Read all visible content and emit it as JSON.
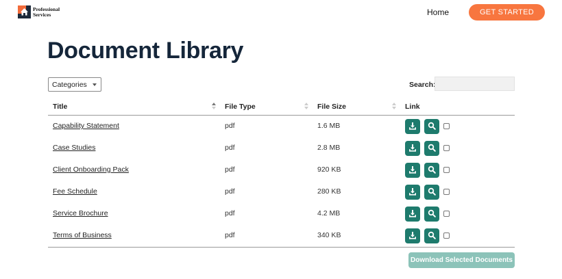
{
  "header": {
    "logo_line1": "Professional",
    "logo_line2": "Services",
    "nav_home": "Home",
    "cta_label": "GET STARTED"
  },
  "page": {
    "title": "Document Library"
  },
  "controls": {
    "categories_label": "Categories",
    "search_label": "Search:",
    "search_value": ""
  },
  "table": {
    "columns": [
      "Title",
      "File Type",
      "File Size",
      "Link"
    ],
    "rows": [
      {
        "title": "Capability Statement",
        "type": "pdf",
        "size": "1.6 MB"
      },
      {
        "title": "Case Studies",
        "type": "pdf",
        "size": "2.8 MB"
      },
      {
        "title": "Client Onboarding Pack",
        "type": "pdf",
        "size": "920 KB"
      },
      {
        "title": "Fee Schedule",
        "type": "pdf",
        "size": "280 KB"
      },
      {
        "title": "Service Brochure",
        "type": "pdf",
        "size": "4.2 MB"
      },
      {
        "title": "Terms of Business",
        "type": "pdf",
        "size": "340 KB"
      }
    ]
  },
  "footer": {
    "download_selected_label": "Download Selected Documents"
  },
  "colors": {
    "accent_orange": "#f8763f",
    "button_teal": "#1e7b6d",
    "button_teal_disabled": "#8cc3b9",
    "title_navy": "#15263a"
  },
  "icons": {
    "download": "download-icon",
    "view": "search-icon"
  }
}
